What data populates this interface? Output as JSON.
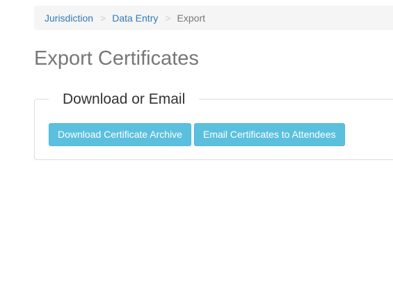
{
  "breadcrumb": {
    "items": [
      {
        "label": "Jurisdiction"
      },
      {
        "label": "Data Entry"
      }
    ],
    "separator": ">",
    "current": "Export"
  },
  "page": {
    "title": "Export Certificates"
  },
  "section": {
    "legend": "Download or Email",
    "buttons": {
      "download": "Download Certificate Archive",
      "email": "Email Certificates to Attendees"
    }
  },
  "colors": {
    "button_info": "#5bc0de",
    "link": "#337ab7",
    "muted": "#777777"
  }
}
